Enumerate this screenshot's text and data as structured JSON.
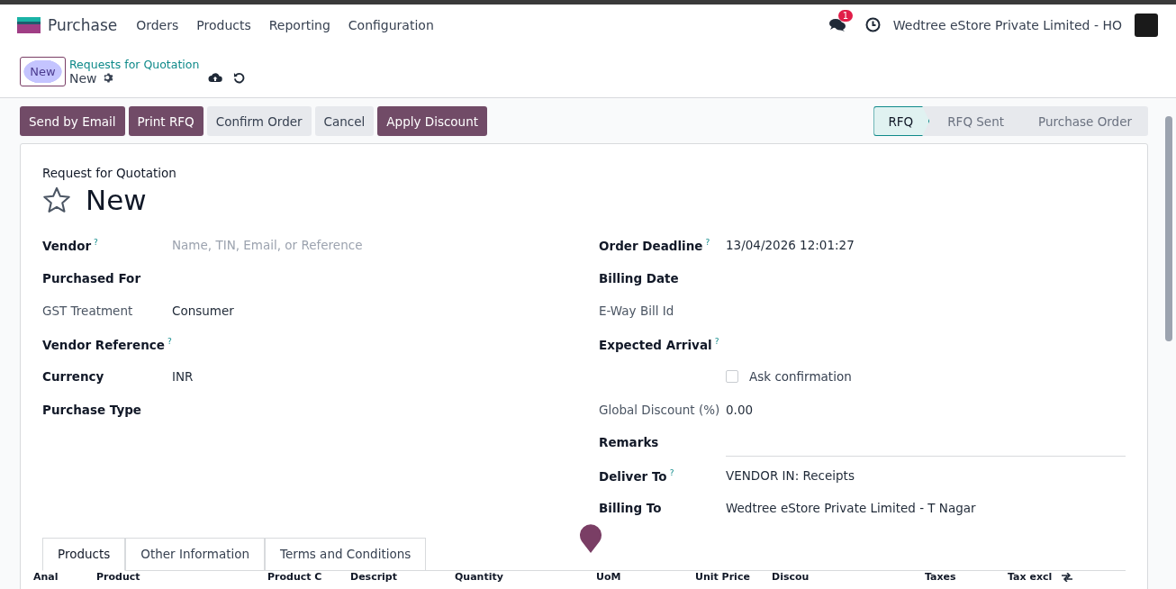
{
  "navbar": {
    "app_name": "Purchase",
    "menu": [
      "Orders",
      "Products",
      "Reporting",
      "Configuration"
    ],
    "messages_badge": "1",
    "company": "Wedtree eStore Private Limited - HO"
  },
  "breadcrumb": {
    "new_button": "New",
    "parent": "Requests for Quotation",
    "current": "New"
  },
  "actions": [
    {
      "label": "Send by Email",
      "kind": "primary"
    },
    {
      "label": "Print RFQ",
      "kind": "primary"
    },
    {
      "label": "Confirm Order",
      "kind": "secondary"
    },
    {
      "label": "Cancel",
      "kind": "secondary"
    },
    {
      "label": "Apply Discount",
      "kind": "primary"
    }
  ],
  "stages": [
    {
      "label": "RFQ",
      "selected": true
    },
    {
      "label": "RFQ Sent",
      "selected": false
    },
    {
      "label": "Purchase Order",
      "selected": false
    }
  ],
  "form": {
    "subtitle": "Request for Quotation",
    "title": "New",
    "favorite": false,
    "left_fields": [
      {
        "kind": "text",
        "label": "Vendor",
        "help": "?",
        "readonly": false,
        "placeholder": "Name, TIN, Email, or Reference"
      },
      {
        "kind": "text",
        "label": "Purchased For",
        "readonly": false
      },
      {
        "kind": "text",
        "label": "GST Treatment",
        "readonly": true,
        "value": "Consumer"
      },
      {
        "kind": "text",
        "label": "Vendor Reference",
        "help": "?",
        "readonly": false
      },
      {
        "kind": "text",
        "label": "Currency",
        "readonly": false,
        "value": "INR"
      },
      {
        "kind": "text",
        "label": "Purchase Type",
        "readonly": false
      }
    ],
    "right_fields": [
      {
        "kind": "text",
        "label": "Order Deadline",
        "help": "?",
        "readonly": false,
        "value": "13/04/2026 12:01:27"
      },
      {
        "kind": "text",
        "label": "Billing Date",
        "readonly": false
      },
      {
        "kind": "text",
        "label": "E-Way Bill Id",
        "readonly": true
      },
      {
        "kind": "text",
        "label": "Expected Arrival",
        "help": "?",
        "readonly": false
      },
      {
        "kind": "checkbox",
        "label": "Ask confirmation",
        "checked": false
      },
      {
        "kind": "text",
        "label": "Global Discount (%)",
        "readonly": true,
        "value": "0.00"
      },
      {
        "kind": "note",
        "label": "Remarks",
        "readonly": false
      },
      {
        "kind": "text",
        "label": "Deliver To",
        "help": "?",
        "readonly": false,
        "value": "VENDOR IN: Receipts"
      },
      {
        "kind": "text",
        "label": "Billing To",
        "readonly": false,
        "value": "Wedtree eStore Private Limited - T Nagar"
      }
    ]
  },
  "tabs": [
    {
      "label": "Products",
      "selected": true
    },
    {
      "label": "Other Information",
      "selected": false
    },
    {
      "label": "Terms and Conditions",
      "selected": false
    }
  ],
  "table": {
    "columns": [
      "Anal",
      "Product",
      "Product C",
      "Descript",
      "Quantity",
      "UoM",
      "Unit Price",
      "Discou",
      "Taxes",
      "Tax excl"
    ]
  }
}
